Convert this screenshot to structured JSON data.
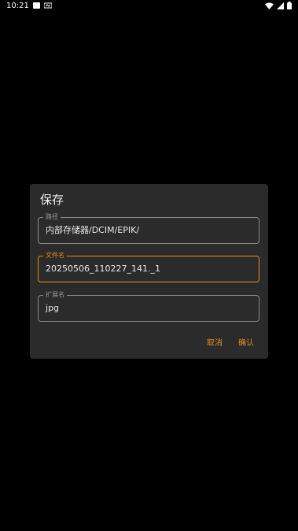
{
  "status_bar": {
    "time": "10:21",
    "left_icons": [
      "notification-square-icon",
      "cast-icon"
    ],
    "right_icons": [
      "wifi-icon",
      "signal-icon",
      "battery-icon"
    ]
  },
  "dialog": {
    "title": "保存",
    "fields": {
      "path": {
        "label": "路径",
        "value": "内部存储器/DCIM/EPIK/"
      },
      "filename": {
        "label": "文件名",
        "value": "20250506_110227_141._1"
      },
      "extension": {
        "label": "扩展名",
        "value": "jpg"
      }
    },
    "buttons": {
      "cancel": "取消",
      "confirm": "确认"
    }
  },
  "colors": {
    "background": "#000000",
    "dialog_bg": "#2b2b2b",
    "accent": "#e48c1f",
    "outline": "#8a8a8a"
  }
}
